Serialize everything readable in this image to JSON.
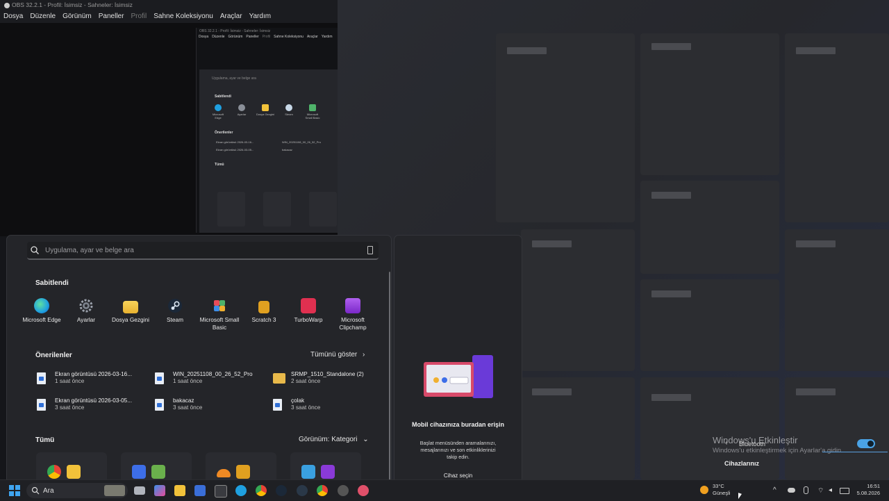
{
  "obs": {
    "title": "OBS 32.2.1 - Profil: İsimsiz - Sahneler: İsimsiz",
    "menu": [
      "Dosya",
      "Düzenle",
      "Görünüm",
      "Paneller",
      "Profil",
      "Sahne Koleksiyonu",
      "Araçlar",
      "Yardım"
    ]
  },
  "nested": {
    "title": "OBS 32.2.1 - Profil: İsimsiz - Sahneler: İsimsiz",
    "menu": [
      "Dosya",
      "Düzenle",
      "Görünüm",
      "Paneller",
      "Profil",
      "Sahne Koleksiyonu",
      "Araçlar",
      "Yardım"
    ],
    "search_placeholder": "Uygulama, ayar ve belge ara",
    "pinned_title": "Sabitlendi",
    "pinned": [
      "Microsoft Edge",
      "Ayarlar",
      "Dosya Gezgini",
      "Steam",
      "Microsoft Small Basic"
    ],
    "recs_title": "Önerilenler",
    "recs": [
      "Ekran görüntüsü 2026-03-16...",
      "WIN_20251108_00_26_52_Pro",
      "Ekran görüntüsü 2026-03-05...",
      "bakacaz"
    ],
    "all_title": "Tümü"
  },
  "start": {
    "search_placeholder": "Uygulama, ayar ve belge ara",
    "pinned_title": "Sabitlendi",
    "pinned": [
      {
        "label": "Microsoft Edge",
        "color": "#1fa0e0"
      },
      {
        "label": "Ayarlar",
        "color": "#8a8f98"
      },
      {
        "label": "Dosya Gezgini",
        "color": "#f2c23a"
      },
      {
        "label": "Steam",
        "color": "#1b2838"
      },
      {
        "label": "Microsoft Small Basic",
        "color": "#4fb36a"
      },
      {
        "label": "Scratch 3",
        "color": "#e0a020"
      },
      {
        "label": "TurboWarp",
        "color": "#e03050"
      },
      {
        "label": "Microsoft Clipchamp",
        "color": "#8a3ad8"
      }
    ],
    "recs_title": "Önerilenler",
    "show_all": "Tümünü göster",
    "recs": [
      {
        "name": "Ekran görüntüsü 2026-03-16...",
        "time": "1 saat önce",
        "type": "file"
      },
      {
        "name": "WIN_20251108_00_26_52_Pro",
        "time": "1 saat önce",
        "type": "file"
      },
      {
        "name": "SRMP_1510_Standalone (2)",
        "time": "2 saat önce",
        "type": "folder"
      },
      {
        "name": "Ekran görüntüsü 2026-03-05...",
        "time": "3 saat önce",
        "type": "file"
      },
      {
        "name": "bakacaz",
        "time": "3 saat önce",
        "type": "file"
      },
      {
        "name": "çolak",
        "time": "3 saat önce",
        "type": "file"
      }
    ],
    "all_title": "Tümü",
    "view_label": "Görünüm: Kategori"
  },
  "phone": {
    "title": "Mobil cihazınıza buradan erişin",
    "desc": "Başlat menüsünden aramalarınızı, mesajlarınızı ve son etkinliklerinizi takip edin.",
    "button": "Cihaz seçin"
  },
  "overlay": {
    "activate_title": "Windows'u Etkinleştir",
    "activate_sub": "Windows'u etkinleştirmek için Ayarlar'a gidin.",
    "bluetooth": "Bluetooth",
    "devices": "Cihazlarınız"
  },
  "taskbar": {
    "search_label": "Ara",
    "weather_temp": "33°C",
    "weather_desc": "Güneşli",
    "time": "16:51",
    "date": "5.08.2026"
  }
}
